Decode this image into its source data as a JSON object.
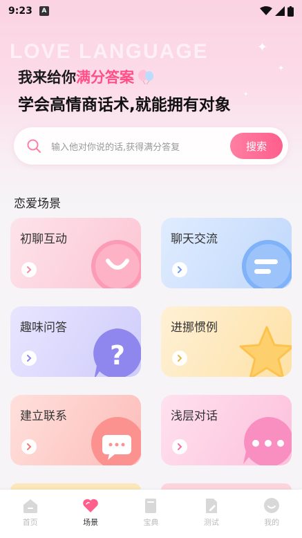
{
  "status": {
    "time": "9:23",
    "a_badge": "A"
  },
  "hero": {
    "watermark": "LOVE LANGUAGE",
    "line1_prefix": "我来给你",
    "line1_highlight": "满分答案",
    "line2": "学会高情商话术,就能拥有对象"
  },
  "search": {
    "placeholder": "输入他对你说的话,获得满分答复",
    "button": "搜索"
  },
  "section": {
    "title": "恋爱场景"
  },
  "cards": [
    {
      "label": "初聊互动"
    },
    {
      "label": "聊天交流"
    },
    {
      "label": "趣味问答"
    },
    {
      "label": "进挪惯例"
    },
    {
      "label": "建立联系"
    },
    {
      "label": "浅层对话"
    }
  ],
  "tabs": [
    {
      "label": "首页",
      "icon": "home-icon"
    },
    {
      "label": "场景",
      "icon": "heart-icon"
    },
    {
      "label": "宝典",
      "icon": "book-icon"
    },
    {
      "label": "测试",
      "icon": "test-icon"
    },
    {
      "label": "我的",
      "icon": "profile-icon"
    }
  ],
  "colors": {
    "accent": "#ff4f88",
    "button": "#ff5f8c"
  }
}
